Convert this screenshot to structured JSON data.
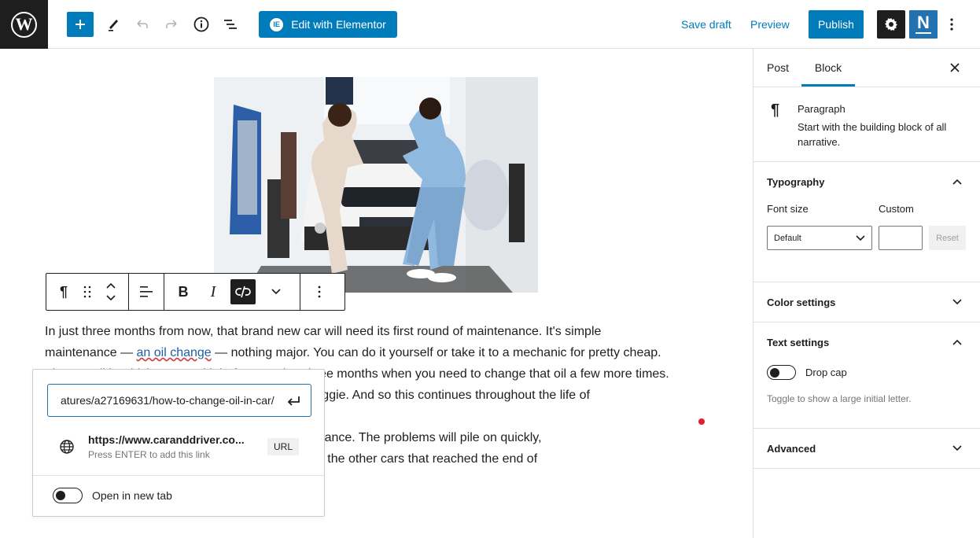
{
  "header": {
    "logo": "W",
    "add_block_icon": "plus-icon",
    "tools_icon": "pencil-icon",
    "undo_icon": "undo-icon",
    "redo_icon": "redo-icon",
    "info_icon": "info-icon",
    "list_view_icon": "list-view-icon",
    "elementor_label": "Edit with Elementor",
    "elementor_badge": "IE",
    "save_draft": "Save draft",
    "preview": "Preview",
    "publish": "Publish",
    "settings_icon": "gear-icon",
    "plugin_letter": "N",
    "more_icon": "⋮"
  },
  "editor": {
    "image_alt": "Couple celebrating in front of a new car at a dealership",
    "paragraph": {
      "line1": "In just three months from now, that brand new car will need its first round of maintenance. It's simple",
      "line2_pre": "maintenance — ",
      "line2_link": "an oil change",
      "line2_post": " — nothing major. You can do it yourself or take it to a mechanic for pretty cheap.",
      "line3": "Then you'll be driving around it before another three months when you need to change that oil a few more times.",
      "line4": "Eventually, you'll need new brake pads, too. No biggie. And so this continues throughout the life of",
      "line5": "",
      "line6": "Your car can't go a single day without any maintenance. The problems will pile on quickly,",
      "line7": "and it will end up in a junkyard somewhere with all the other cars that reached the end of"
    }
  },
  "block_toolbar": {
    "paragraph_icon": "¶",
    "drag_icon": "⠿",
    "align_icon": "align-icon",
    "bold": "B",
    "italic": "I",
    "unlink_icon": "unlink-icon",
    "more_rich_text_icon": "chevron-down-icon",
    "options_icon": "⋮"
  },
  "link_popover": {
    "url_value": "atures/a27169631/how-to-change-oil-in-car/",
    "suggestion_title": "https://www.caranddriver.co...",
    "suggestion_hint": "Press ENTER to add this link",
    "suggestion_type": "URL",
    "open_new_tab_label": "Open in new tab",
    "open_new_tab": false
  },
  "sidebar": {
    "tabs": [
      {
        "label": "Post",
        "active": false
      },
      {
        "label": "Block",
        "active": true
      }
    ],
    "block_card": {
      "icon": "¶",
      "title": "Paragraph",
      "description": "Start with the building block of all narrative."
    },
    "typography": {
      "title": "Typography",
      "expanded": true,
      "font_size_label": "Font size",
      "custom_label": "Custom",
      "font_size_value": "Default",
      "custom_value": "",
      "reset_label": "Reset"
    },
    "color_settings": {
      "title": "Color settings",
      "expanded": false
    },
    "text_settings": {
      "title": "Text settings",
      "expanded": true,
      "drop_cap_label": "Drop cap",
      "drop_cap": false,
      "help": "Toggle to show a large initial letter."
    },
    "advanced": {
      "title": "Advanced",
      "expanded": false
    }
  },
  "colors": {
    "accent": "#007cba",
    "dark": "#1e1e1e",
    "border": "#e0e0e0",
    "notice_dot": "#e11d2e"
  }
}
